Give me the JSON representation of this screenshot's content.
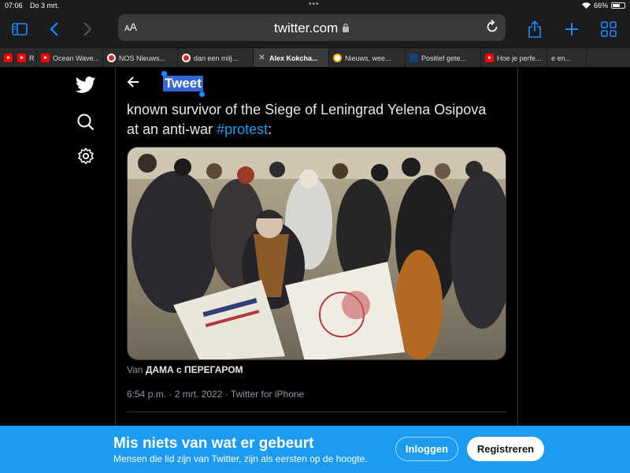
{
  "status": {
    "time": "07:06",
    "date": "Do 3 mrt.",
    "battery": "66%",
    "battery_level": 0.66
  },
  "toolbar": {
    "aa": "AA",
    "url": "twitter.com"
  },
  "tabs": [
    {
      "label": "",
      "favicon": "youtube",
      "active": false
    },
    {
      "label": "R",
      "favicon": "youtube",
      "active": false
    },
    {
      "label": "Ocean Wave...",
      "favicon": "youtube",
      "active": false
    },
    {
      "label": "NOS Nieuws...",
      "favicon": "nos",
      "active": false
    },
    {
      "label": "dan een milj...",
      "favicon": "nos",
      "active": false
    },
    {
      "label": "Alex Kokcha...",
      "favicon": "close",
      "active": true
    },
    {
      "label": "Nieuws, wee...",
      "favicon": "google",
      "active": false
    },
    {
      "label": "Positief gete...",
      "favicon": "rijksoverheid",
      "active": false
    },
    {
      "label": "Hoe je perfe...",
      "favicon": "youtube",
      "active": false
    },
    {
      "label": "e en...",
      "favicon": "",
      "active": false
    }
  ],
  "page": {
    "header_title": "Tweet",
    "text_before": "known survivor of the Siege of Leningrad Yelena Osipova at an anti-war ",
    "hashtag": "#protest",
    "text_after": ":",
    "credit_prefix": "Van",
    "credit_name": "ДАМА с ПЕРЕГАРОМ",
    "meta": "6:54 p.m. · 2 mrt. 2022 · Twitter for iPhone"
  },
  "banner": {
    "title": "Mis niets van wat er gebeurt",
    "subtitle": "Mensen die lid zijn van Twitter, zijn als eersten op de hoogte.",
    "login": "Inloggen",
    "register": "Registreren"
  },
  "colors": {
    "accent": "#1d9bf0",
    "safari_blue": "#1a8cff"
  }
}
